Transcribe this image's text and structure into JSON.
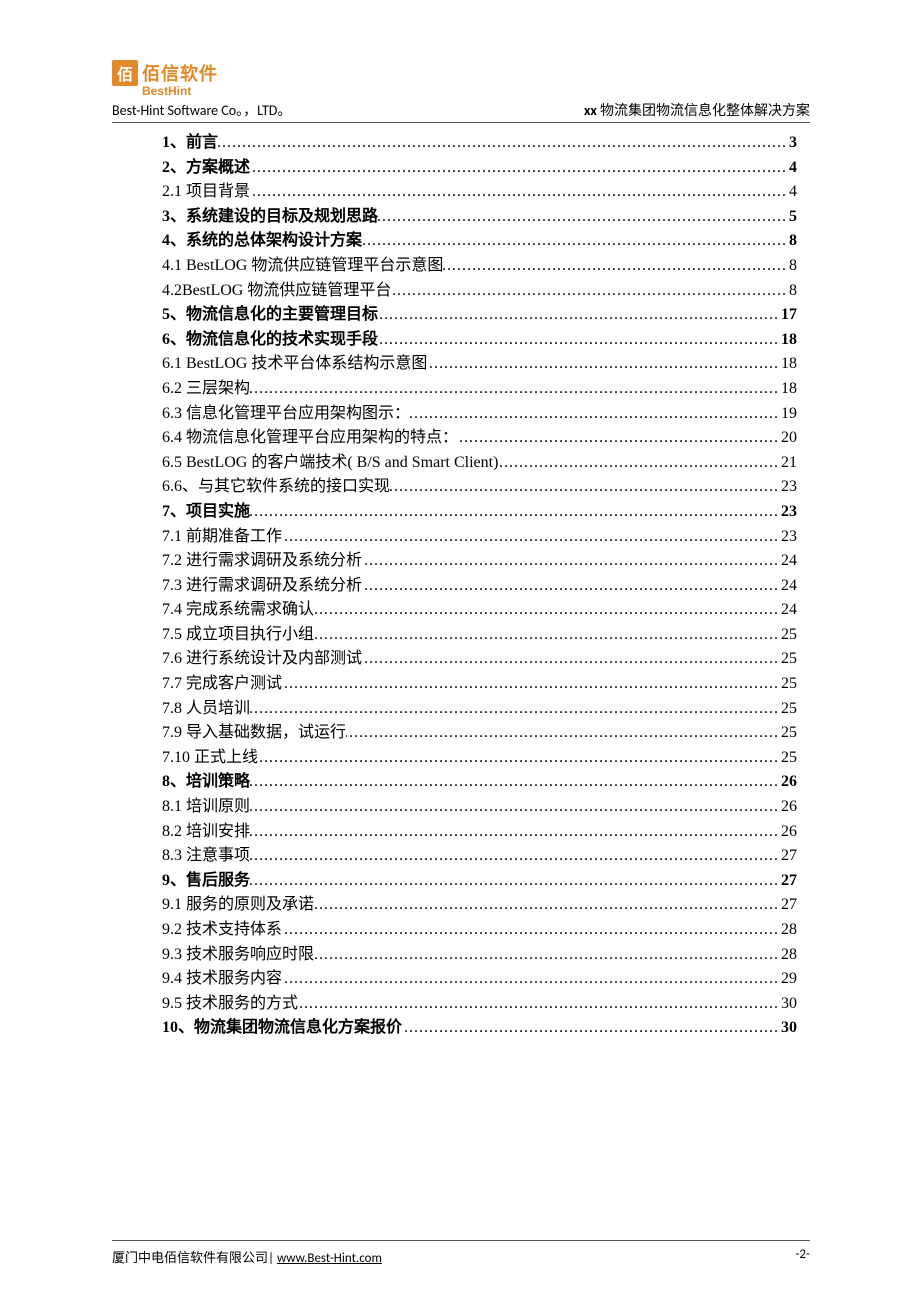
{
  "logo": {
    "square_char": "佰",
    "text_cn": "佰信软件",
    "text_en": "BestHint"
  },
  "header": {
    "left": "Best-Hint Software Co。，LTD。",
    "right_bold": "xx",
    "right_rest": " 物流集团物流信息化整体解决方案"
  },
  "toc": [
    {
      "label": "1、前言",
      "page": "3",
      "bold": true
    },
    {
      "label": "2、方案概述",
      "page": "4",
      "bold": true
    },
    {
      "label": "2.1 项目背景",
      "page": "4",
      "bold": false
    },
    {
      "label": "3、系统建设的目标及规划思路",
      "page": "5",
      "bold": true
    },
    {
      "label": "4、系统的总体架构设计方案",
      "page": "8",
      "bold": true
    },
    {
      "label": "4.1 BestLOG 物流供应链管理平台示意图",
      "page": "8",
      "bold": false
    },
    {
      "label": "4.2BestLOG 物流供应链管理平台",
      "page": "8",
      "bold": false
    },
    {
      "label": "5、物流信息化的主要管理目标",
      "page": "17",
      "bold": true
    },
    {
      "label": "6、物流信息化的技术实现手段",
      "page": "18",
      "bold": true
    },
    {
      "label": "6.1 BestLOG 技术平台体系结构示意图",
      "page": "18",
      "bold": false
    },
    {
      "label": "6.2 三层架构",
      "page": "18",
      "bold": false
    },
    {
      "label": "6.3 信息化管理平台应用架构图示：",
      "page": "19",
      "bold": false
    },
    {
      "label": "6.4 物流信息化管理平台应用架构的特点：",
      "page": "20",
      "bold": false
    },
    {
      "label": "6.5 BestLOG 的客户端技术( B/S and Smart Client)",
      "page": "21",
      "bold": false
    },
    {
      "label": "6.6、与其它软件系统的接口实现",
      "page": "23",
      "bold": false
    },
    {
      "label": "7、项目实施",
      "page": "23",
      "bold": true
    },
    {
      "label": "7.1 前期准备工作",
      "page": "23",
      "bold": false
    },
    {
      "label": "7.2 进行需求调研及系统分析",
      "page": "24",
      "bold": false
    },
    {
      "label": "7.3 进行需求调研及系统分析",
      "page": "24",
      "bold": false
    },
    {
      "label": "7.4 完成系统需求确认",
      "page": "24",
      "bold": false
    },
    {
      "label": "7.5 成立项目执行小组",
      "page": "25",
      "bold": false
    },
    {
      "label": "7.6 进行系统设计及内部测试",
      "page": "25",
      "bold": false
    },
    {
      "label": "7.7 完成客户测试",
      "page": "25",
      "bold": false
    },
    {
      "label": "7.8 人员培训",
      "page": "25",
      "bold": false
    },
    {
      "label": "7.9 导入基础数据，试运行",
      "page": "25",
      "bold": false
    },
    {
      "label": "7.10 正式上线",
      "page": "25",
      "bold": false
    },
    {
      "label": "8、培训策略",
      "page": "26",
      "bold": true
    },
    {
      "label": "8.1 培训原则",
      "page": "26",
      "bold": false
    },
    {
      "label": "8.2 培训安排",
      "page": "26",
      "bold": false
    },
    {
      "label": "8.3 注意事项",
      "page": "27",
      "bold": false
    },
    {
      "label": "9、售后服务",
      "page": "27",
      "bold": true
    },
    {
      "label": "9.1 服务的原则及承诺",
      "page": "27",
      "bold": false
    },
    {
      "label": "9.2 技术支持体系",
      "page": "28",
      "bold": false
    },
    {
      "label": "9.3 技术服务响应时限",
      "page": "28",
      "bold": false
    },
    {
      "label": "9.4 技术服务内容",
      "page": "29",
      "bold": false
    },
    {
      "label": "9.5 技术服务的方式",
      "page": "30",
      "bold": false
    },
    {
      "label": "10、物流集团物流信息化方案报价",
      "page": "30",
      "bold": true
    }
  ],
  "footer": {
    "company": "厦门中电佰信软件有限公司",
    "separator": "| ",
    "link": "www.Best-Hint.com",
    "page_num": "-2-"
  }
}
